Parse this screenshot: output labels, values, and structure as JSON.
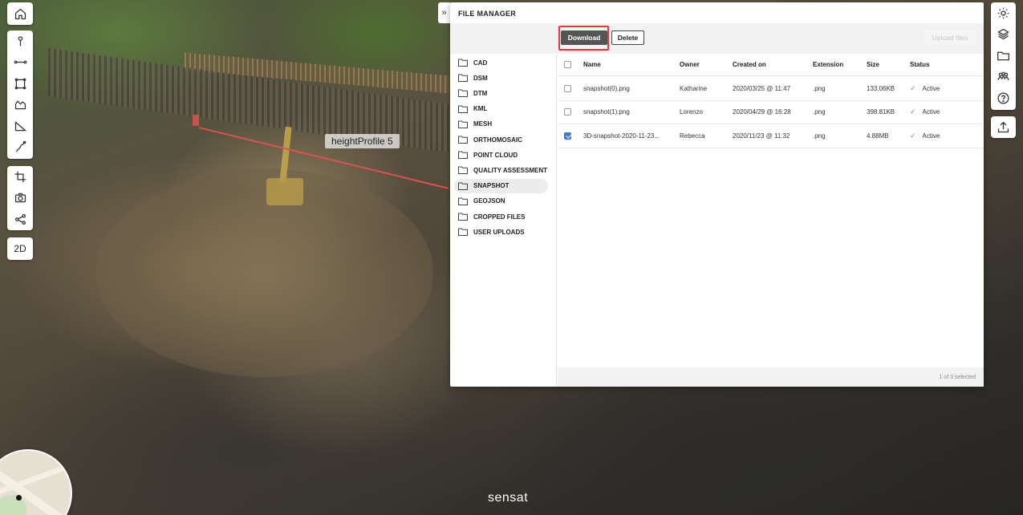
{
  "scene": {
    "profile_label": "heightProfile 5",
    "brand": "sensat"
  },
  "left_toolbar": {
    "home_icon": "home-icon",
    "tools": [
      "point-icon",
      "line-measure-icon",
      "area-icon",
      "volume-icon",
      "height-profile-icon",
      "path-icon",
      "crop-icon",
      "camera-icon",
      "share-icon"
    ],
    "mode_label": "2D"
  },
  "right_toolbar": {
    "icons": [
      "gear-icon",
      "layers-icon",
      "folder-icon",
      "users-icon",
      "help-icon",
      "upload-icon"
    ]
  },
  "file_manager": {
    "collapse_glyph": "»",
    "title": "FILE MANAGER",
    "download_label": "Download",
    "delete_label": "Delete",
    "upload_label": "Upload files",
    "folders": [
      {
        "label": "CAD",
        "active": false
      },
      {
        "label": "DSM",
        "active": false
      },
      {
        "label": "DTM",
        "active": false
      },
      {
        "label": "KML",
        "active": false
      },
      {
        "label": "MESH",
        "active": false
      },
      {
        "label": "ORTHOMOSAIC",
        "active": false
      },
      {
        "label": "POINT CLOUD",
        "active": false
      },
      {
        "label": "QUALITY ASSESSMENT",
        "active": false
      },
      {
        "label": "SNAPSHOT",
        "active": true
      },
      {
        "label": "GEOJSON",
        "active": false
      },
      {
        "label": "CROPPED FILES",
        "active": false
      },
      {
        "label": "USER UPLOADS",
        "active": false
      }
    ],
    "columns": {
      "name": "Name",
      "owner": "Owner",
      "created": "Created on",
      "extension": "Extension",
      "size": "Size",
      "status": "Status"
    },
    "rows": [
      {
        "name": "snapshot(0).png",
        "owner": "Katharine",
        "created": "2020/03/25 @ 11:47",
        "extension": ".png",
        "size": "133.06KB",
        "status": "Active",
        "checked": false
      },
      {
        "name": "snapshot(1).png",
        "owner": "Lorenzo",
        "created": "2020/04/29 @ 16:28",
        "extension": ".png",
        "size": "398.81KB",
        "status": "Active",
        "checked": false
      },
      {
        "name": "3D-snapshot-2020-11-23...",
        "owner": "Rebecca",
        "created": "2020/11/23 @ 11:32",
        "extension": ".png",
        "size": "4.88MB",
        "status": "Active",
        "checked": true
      }
    ],
    "footer": "1 of 3 selected"
  }
}
